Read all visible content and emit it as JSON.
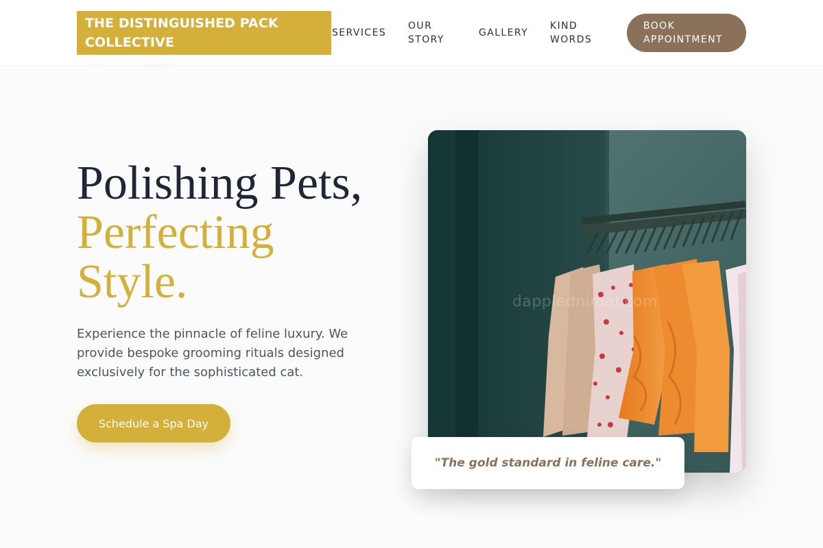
{
  "header": {
    "logo_text": "THE DISTINGUISHED PACK COLLECTIVE",
    "nav": {
      "services": "SERVICES",
      "our_story_line1": "OUR",
      "our_story_line2": "STORY",
      "gallery": "GALLERY",
      "kind_words_line1": "KIND",
      "kind_words_line2": "WORDS"
    },
    "book_line1": "BOOK",
    "book_line2": "APPOINTMENT"
  },
  "hero": {
    "headline_line1": "Polishing Pets,",
    "headline_accent_line1": "Perfecting",
    "headline_accent_line2": "Style.",
    "tagline": "Experience the pinnacle of feline luxury. We provide bespoke grooming rituals designed exclusively for the sophisticated cat.",
    "cta_label": "Schedule a Spa Day",
    "image_watermark": "dapplednimal.com",
    "quote": "\"The gold standard in feline care.\""
  },
  "colors": {
    "gold": "#d4b03a",
    "brown": "#8b7159",
    "navy": "#1e2638",
    "background": "#fbfbfb"
  }
}
